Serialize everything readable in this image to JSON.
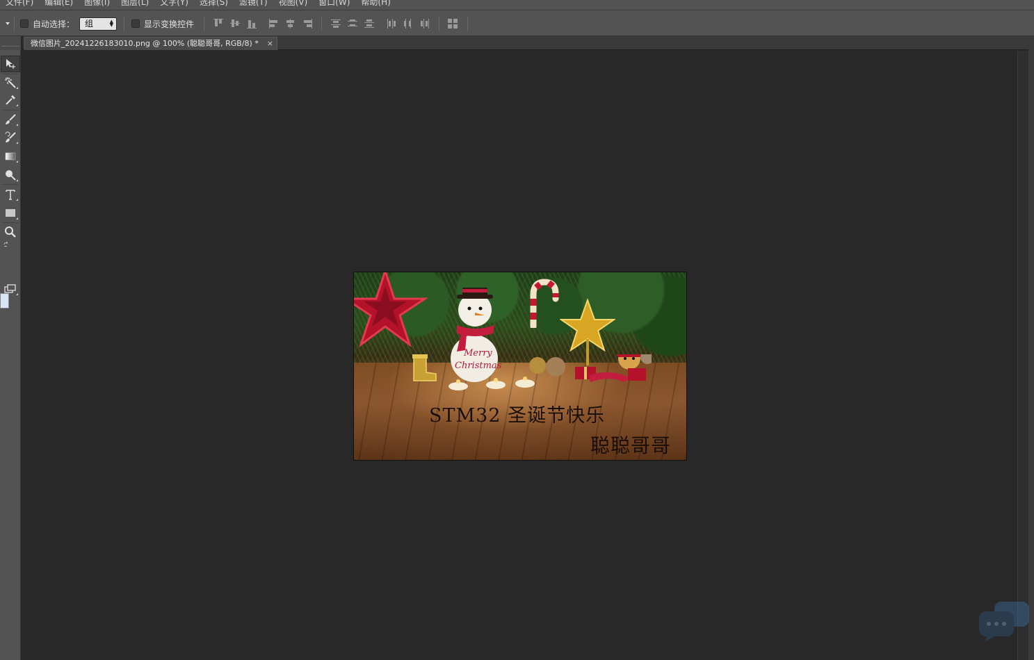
{
  "menu": {
    "items": [
      "文件(F)",
      "编辑(E)",
      "图像(I)",
      "图层(L)",
      "文字(Y)",
      "选择(S)",
      "滤镜(T)",
      "视图(V)",
      "窗口(W)",
      "帮助(H)"
    ]
  },
  "options": {
    "auto_select_label": "自动选择：",
    "auto_select_value": "组",
    "show_transform_label": "显示变换控件"
  },
  "document": {
    "tab_title": "微信图片_20241226183010.png @ 100% (聪聪哥哥, RGB/8) *",
    "close_glyph": "×"
  },
  "image": {
    "caption_main": "STM32 圣诞节快乐",
    "caption_sign": "聪聪哥哥",
    "merry_text": "Merry",
    "christmas_text": "Christmas"
  },
  "colors": {
    "ui_panel": "#535353",
    "canvas_bg": "#282828",
    "foreground_swatch": "#d6e6f6"
  },
  "toolbox_icons": [
    "move-icon",
    "magic-wand-icon",
    "eyedropper-icon",
    "brush-icon",
    "history-brush-icon",
    "gradient-icon",
    "dodge-icon",
    "type-icon",
    "rectangle-icon",
    "zoom-icon",
    "swap-colors-icon",
    "screen-mode-icon"
  ]
}
